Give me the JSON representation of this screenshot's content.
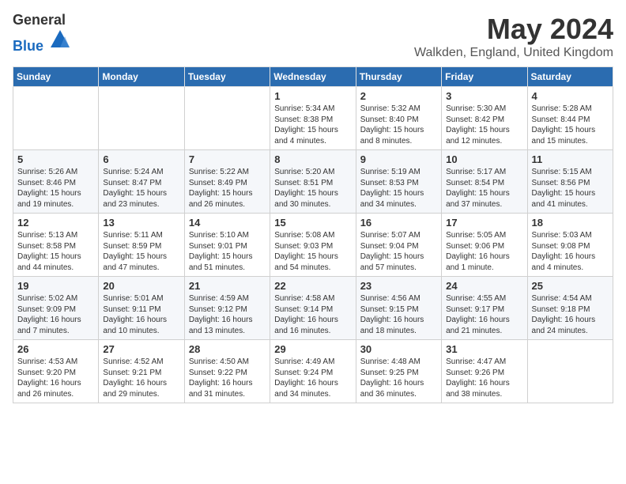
{
  "header": {
    "logo_general": "General",
    "logo_blue": "Blue",
    "month_title": "May 2024",
    "location": "Walkden, England, United Kingdom"
  },
  "days_of_week": [
    "Sunday",
    "Monday",
    "Tuesday",
    "Wednesday",
    "Thursday",
    "Friday",
    "Saturday"
  ],
  "weeks": [
    {
      "cells": [
        {
          "day": null,
          "content": null
        },
        {
          "day": null,
          "content": null
        },
        {
          "day": null,
          "content": null
        },
        {
          "day": "1",
          "content": "Sunrise: 5:34 AM\nSunset: 8:38 PM\nDaylight: 15 hours\nand 4 minutes."
        },
        {
          "day": "2",
          "content": "Sunrise: 5:32 AM\nSunset: 8:40 PM\nDaylight: 15 hours\nand 8 minutes."
        },
        {
          "day": "3",
          "content": "Sunrise: 5:30 AM\nSunset: 8:42 PM\nDaylight: 15 hours\nand 12 minutes."
        },
        {
          "day": "4",
          "content": "Sunrise: 5:28 AM\nSunset: 8:44 PM\nDaylight: 15 hours\nand 15 minutes."
        }
      ]
    },
    {
      "cells": [
        {
          "day": "5",
          "content": "Sunrise: 5:26 AM\nSunset: 8:46 PM\nDaylight: 15 hours\nand 19 minutes."
        },
        {
          "day": "6",
          "content": "Sunrise: 5:24 AM\nSunset: 8:47 PM\nDaylight: 15 hours\nand 23 minutes."
        },
        {
          "day": "7",
          "content": "Sunrise: 5:22 AM\nSunset: 8:49 PM\nDaylight: 15 hours\nand 26 minutes."
        },
        {
          "day": "8",
          "content": "Sunrise: 5:20 AM\nSunset: 8:51 PM\nDaylight: 15 hours\nand 30 minutes."
        },
        {
          "day": "9",
          "content": "Sunrise: 5:19 AM\nSunset: 8:53 PM\nDaylight: 15 hours\nand 34 minutes."
        },
        {
          "day": "10",
          "content": "Sunrise: 5:17 AM\nSunset: 8:54 PM\nDaylight: 15 hours\nand 37 minutes."
        },
        {
          "day": "11",
          "content": "Sunrise: 5:15 AM\nSunset: 8:56 PM\nDaylight: 15 hours\nand 41 minutes."
        }
      ]
    },
    {
      "cells": [
        {
          "day": "12",
          "content": "Sunrise: 5:13 AM\nSunset: 8:58 PM\nDaylight: 15 hours\nand 44 minutes."
        },
        {
          "day": "13",
          "content": "Sunrise: 5:11 AM\nSunset: 8:59 PM\nDaylight: 15 hours\nand 47 minutes."
        },
        {
          "day": "14",
          "content": "Sunrise: 5:10 AM\nSunset: 9:01 PM\nDaylight: 15 hours\nand 51 minutes."
        },
        {
          "day": "15",
          "content": "Sunrise: 5:08 AM\nSunset: 9:03 PM\nDaylight: 15 hours\nand 54 minutes."
        },
        {
          "day": "16",
          "content": "Sunrise: 5:07 AM\nSunset: 9:04 PM\nDaylight: 15 hours\nand 57 minutes."
        },
        {
          "day": "17",
          "content": "Sunrise: 5:05 AM\nSunset: 9:06 PM\nDaylight: 16 hours\nand 1 minute."
        },
        {
          "day": "18",
          "content": "Sunrise: 5:03 AM\nSunset: 9:08 PM\nDaylight: 16 hours\nand 4 minutes."
        }
      ]
    },
    {
      "cells": [
        {
          "day": "19",
          "content": "Sunrise: 5:02 AM\nSunset: 9:09 PM\nDaylight: 16 hours\nand 7 minutes."
        },
        {
          "day": "20",
          "content": "Sunrise: 5:01 AM\nSunset: 9:11 PM\nDaylight: 16 hours\nand 10 minutes."
        },
        {
          "day": "21",
          "content": "Sunrise: 4:59 AM\nSunset: 9:12 PM\nDaylight: 16 hours\nand 13 minutes."
        },
        {
          "day": "22",
          "content": "Sunrise: 4:58 AM\nSunset: 9:14 PM\nDaylight: 16 hours\nand 16 minutes."
        },
        {
          "day": "23",
          "content": "Sunrise: 4:56 AM\nSunset: 9:15 PM\nDaylight: 16 hours\nand 18 minutes."
        },
        {
          "day": "24",
          "content": "Sunrise: 4:55 AM\nSunset: 9:17 PM\nDaylight: 16 hours\nand 21 minutes."
        },
        {
          "day": "25",
          "content": "Sunrise: 4:54 AM\nSunset: 9:18 PM\nDaylight: 16 hours\nand 24 minutes."
        }
      ]
    },
    {
      "cells": [
        {
          "day": "26",
          "content": "Sunrise: 4:53 AM\nSunset: 9:20 PM\nDaylight: 16 hours\nand 26 minutes."
        },
        {
          "day": "27",
          "content": "Sunrise: 4:52 AM\nSunset: 9:21 PM\nDaylight: 16 hours\nand 29 minutes."
        },
        {
          "day": "28",
          "content": "Sunrise: 4:50 AM\nSunset: 9:22 PM\nDaylight: 16 hours\nand 31 minutes."
        },
        {
          "day": "29",
          "content": "Sunrise: 4:49 AM\nSunset: 9:24 PM\nDaylight: 16 hours\nand 34 minutes."
        },
        {
          "day": "30",
          "content": "Sunrise: 4:48 AM\nSunset: 9:25 PM\nDaylight: 16 hours\nand 36 minutes."
        },
        {
          "day": "31",
          "content": "Sunrise: 4:47 AM\nSunset: 9:26 PM\nDaylight: 16 hours\nand 38 minutes."
        },
        {
          "day": null,
          "content": null
        }
      ]
    }
  ]
}
